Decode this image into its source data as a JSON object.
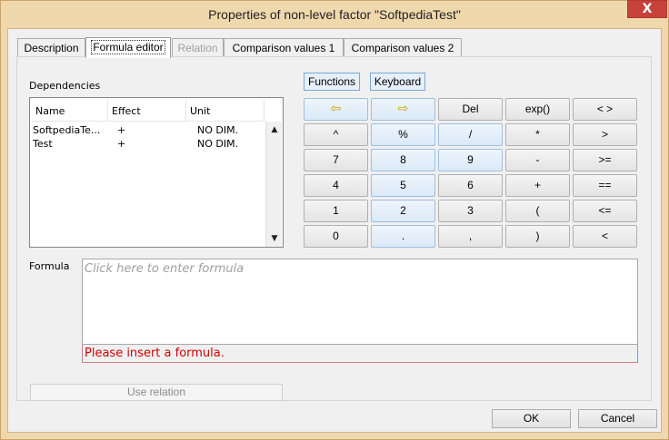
{
  "window": {
    "title": "Properties of non-level factor \"SoftpediaTest\"",
    "close_glyph": "X"
  },
  "tabs": [
    {
      "label": "Description",
      "state": "normal"
    },
    {
      "label": "Formula editor",
      "state": "active"
    },
    {
      "label": "Relation",
      "state": "disabled"
    },
    {
      "label": "Comparison values 1",
      "state": "normal"
    },
    {
      "label": "Comparison values 2",
      "state": "normal"
    }
  ],
  "dependencies": {
    "label": "Dependencies",
    "columns": [
      "Name",
      "Effect",
      "Unit"
    ],
    "rows": [
      {
        "name": "SoftpediaTe...",
        "effect": "+",
        "unit": "NO DIM."
      },
      {
        "name": "Test",
        "effect": "+",
        "unit": "NO DIM."
      }
    ]
  },
  "keypad": {
    "functions_label": "Functions",
    "keyboard_label": "Keyboard",
    "keys": [
      [
        "⇦",
        "⇨",
        "Del",
        "exp()",
        "< >"
      ],
      [
        "^",
        "%",
        "/",
        "*",
        ">"
      ],
      [
        "7",
        "8",
        "9",
        "-",
        ">="
      ],
      [
        "4",
        "5",
        "6",
        "+",
        "=="
      ],
      [
        "1",
        "2",
        "3",
        "(",
        "<="
      ],
      [
        "0",
        ".",
        ",",
        ")",
        "<"
      ]
    ]
  },
  "formula": {
    "label": "Formula",
    "placeholder": "Click here to enter formula",
    "error": "Please insert a formula."
  },
  "use_relation_label": "Use relation",
  "footer": {
    "ok_label": "OK",
    "cancel_label": "Cancel"
  }
}
